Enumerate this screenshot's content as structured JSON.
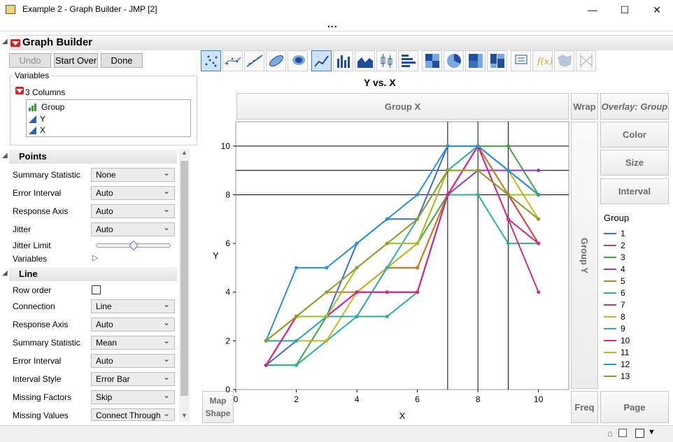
{
  "window": {
    "title": "Example 2 - Graph Builder - JMP [2]",
    "controls": [
      "minimize-icon",
      "maximize-icon",
      "close-icon"
    ],
    "overflow": "..."
  },
  "panel": {
    "title": "Graph Builder",
    "buttons": {
      "undo": "Undo",
      "start_over": "Start Over",
      "done": "Done"
    },
    "variables_label": "Variables",
    "columns_label": "3 Columns",
    "columns": [
      {
        "name": "Group",
        "icon": "nominal-bars-icon"
      },
      {
        "name": "Y",
        "icon": "continuous-triangle-icon"
      },
      {
        "name": "X",
        "icon": "continuous-triangle-icon"
      }
    ]
  },
  "points": {
    "header": "Points",
    "summary_statistic": {
      "label": "Summary Statistic",
      "value": "None"
    },
    "error_interval": {
      "label": "Error Interval",
      "value": "Auto"
    },
    "response_axis": {
      "label": "Response Axis",
      "value": "Auto"
    },
    "jitter": {
      "label": "Jitter",
      "value": "Auto"
    },
    "jitter_limit": {
      "label": "Jitter Limit",
      "value": 0.5
    },
    "variables": {
      "label": "Variables"
    }
  },
  "line": {
    "header": "Line",
    "row_order": {
      "label": "Row order",
      "checked": false
    },
    "connection": {
      "label": "Connection",
      "value": "Line"
    },
    "response_axis": {
      "label": "Response Axis",
      "value": "Auto"
    },
    "summary_statistic": {
      "label": "Summary Statistic",
      "value": "Mean"
    },
    "error_interval": {
      "label": "Error Interval",
      "value": "Auto"
    },
    "interval_style": {
      "label": "Interval Style",
      "value": "Error Bar"
    },
    "missing_factors": {
      "label": "Missing Factors",
      "value": "Skip"
    },
    "missing_values": {
      "label": "Missing Values",
      "value": "Connect Through"
    }
  },
  "toolbar": {
    "icons": [
      "points-icon",
      "smoother-icon",
      "line-of-fit-icon",
      "ellipse-icon",
      "contour-icon",
      "line-icon",
      "bar-icon",
      "area-icon",
      "box-plot-icon",
      "histogram-icon",
      "heatmap-icon",
      "pie-icon",
      "treemap-icon",
      "mosaic-icon",
      "caption-box-icon",
      "formula-icon",
      "map-shapes-icon",
      "parallel-icon"
    ],
    "selected": [
      "points-icon",
      "line-icon"
    ]
  },
  "graph": {
    "zones": {
      "group_x": "Group X",
      "wrap": "Wrap",
      "overlay": "Overlay: Group",
      "color": "Color",
      "size": "Size",
      "interval": "Interval",
      "group_y": "Group Y",
      "map_shape": "Map Shape",
      "freq": "Freq",
      "page": "Page"
    },
    "legend_title": "Group"
  },
  "chart_data": {
    "type": "line",
    "title": "Y vs. X",
    "xlabel": "X",
    "ylabel": "Y",
    "xlim": [
      0,
      11
    ],
    "ylim": [
      0,
      11
    ],
    "xticks": [
      0,
      2,
      4,
      6,
      8,
      10
    ],
    "yticks": [
      0,
      2,
      4,
      6,
      8,
      10
    ],
    "reference_lines": {
      "x": [
        7,
        8,
        9
      ],
      "y": [
        8,
        9,
        10
      ]
    },
    "x": [
      1,
      2,
      3,
      4,
      5,
      6,
      7,
      8,
      9,
      10
    ],
    "series": [
      {
        "name": "1",
        "color": "#3f6cc4",
        "values": [
          1,
          2,
          3,
          6,
          7,
          7,
          10,
          10,
          9,
          8
        ]
      },
      {
        "name": "2",
        "color": "#d43c3c",
        "values": [
          1,
          3,
          3,
          3,
          5,
          5,
          8,
          10,
          8,
          6
        ]
      },
      {
        "name": "3",
        "color": "#44a043",
        "values": [
          1,
          1,
          3,
          4,
          5,
          6,
          8,
          10,
          10,
          8
        ]
      },
      {
        "name": "4",
        "color": "#9436c4",
        "values": [
          1,
          3,
          3,
          4,
          4,
          4,
          8,
          9,
          9,
          9
        ]
      },
      {
        "name": "5",
        "color": "#c17c26",
        "values": [
          2,
          3,
          4,
          4,
          5,
          5,
          8,
          10,
          8,
          7
        ]
      },
      {
        "name": "6",
        "color": "#2ab38c",
        "values": [
          1,
          1,
          2,
          3,
          3,
          4,
          8,
          8,
          6,
          6
        ]
      },
      {
        "name": "7",
        "color": "#c4318f",
        "values": [
          1,
          3,
          3,
          4,
          4,
          4,
          8,
          10,
          7,
          4
        ]
      },
      {
        "name": "8",
        "color": "#c9b32a",
        "values": [
          2,
          2,
          2,
          4,
          5,
          6,
          9,
          10,
          9,
          7
        ]
      },
      {
        "name": "9",
        "color": "#31a9b8",
        "values": [
          2,
          2,
          3,
          3,
          5,
          7,
          9,
          10,
          9,
          8
        ]
      },
      {
        "name": "10",
        "color": "#cf2b8a",
        "values": [
          1,
          3,
          3,
          4,
          4,
          4,
          8,
          10,
          7,
          6
        ]
      },
      {
        "name": "11",
        "color": "#9fbf2a",
        "values": [
          2,
          3,
          3,
          5,
          6,
          6,
          9,
          9,
          8,
          8
        ]
      },
      {
        "name": "12",
        "color": "#2e8fd0",
        "values": [
          2,
          5,
          5,
          6,
          7,
          8,
          10,
          10,
          9,
          8
        ]
      },
      {
        "name": "13",
        "color": "#8f9a2a",
        "values": [
          2,
          3,
          4,
          5,
          6,
          7,
          9,
          9,
          8,
          7
        ]
      }
    ]
  }
}
